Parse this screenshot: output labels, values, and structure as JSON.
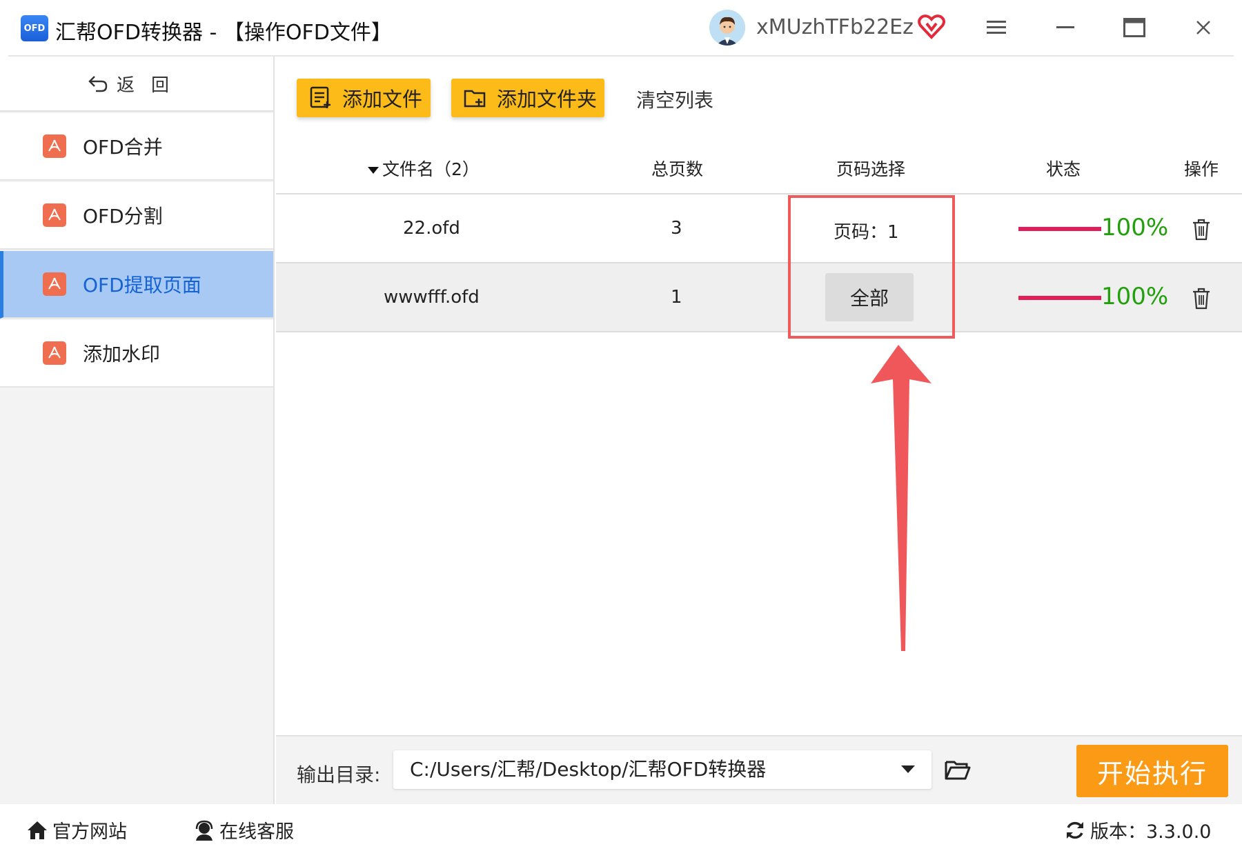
{
  "window": {
    "logo_text": "OFD",
    "title": "汇帮OFD转换器 - 【操作OFD文件】",
    "username": "xMUzhTFb22Ez"
  },
  "sidebar": {
    "back_label": "返回",
    "items": [
      {
        "label": "OFD合并",
        "active": false
      },
      {
        "label": "OFD分割",
        "active": false
      },
      {
        "label": "OFD提取页面",
        "active": true
      },
      {
        "label": "添加水印",
        "active": false
      }
    ]
  },
  "toolbar": {
    "add_file": "添加文件",
    "add_folder": "添加文件夹",
    "clear_list": "清空列表"
  },
  "table": {
    "headers": {
      "filename": "文件名（2）",
      "total_pages": "总页数",
      "page_select": "页码选择",
      "status": "状态",
      "action": "操作"
    },
    "rows": [
      {
        "filename": "22.ofd",
        "total_pages": "3",
        "page_select": "页码：1",
        "status": "100%",
        "progress": 1.0
      },
      {
        "filename": "wwwfff.ofd",
        "total_pages": "1",
        "page_select": "全部",
        "status": "100%",
        "progress": 1.0
      }
    ]
  },
  "output": {
    "label": "输出目录:",
    "path": "C:/Users/汇帮/Desktop/汇帮OFD转换器",
    "start_button": "开始执行"
  },
  "footer": {
    "website": "官方网站",
    "support": "在线客服",
    "version": "版本：3.3.0.0"
  },
  "colors": {
    "accent_yellow": "#fdbb1a",
    "start_orange": "#fb9a14",
    "active_item_bg": "#a8c9f3",
    "active_item_text": "#1463d6",
    "progress_bar": "#e21e5a",
    "progress_text": "#22a00c",
    "highlight": "#ef5b5b"
  }
}
